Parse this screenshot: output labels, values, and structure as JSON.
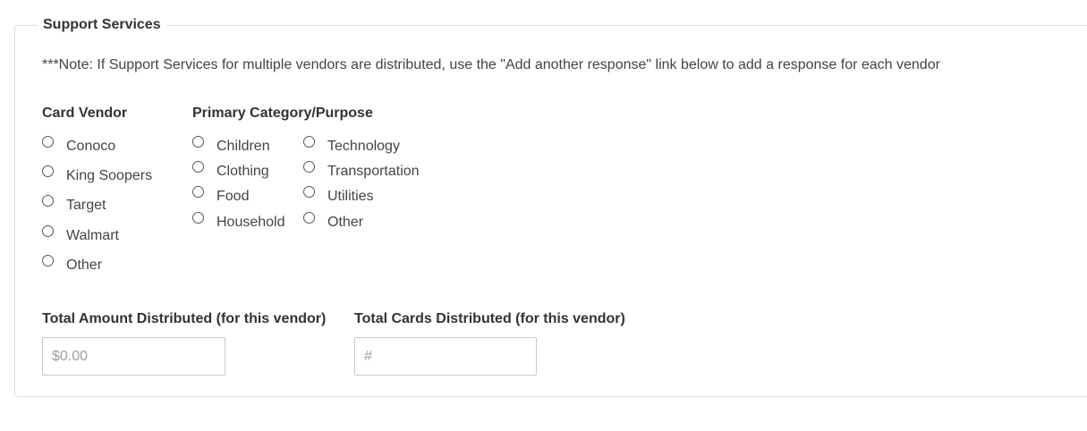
{
  "section": {
    "title": "Support Services",
    "note": "***Note: If Support Services for multiple vendors are distributed, use the \"Add another response\" link below to add a response for each vendor"
  },
  "card_vendor": {
    "label": "Card Vendor",
    "options": [
      "Conoco",
      "King Soopers",
      "Target",
      "Walmart",
      "Other"
    ]
  },
  "primary_category": {
    "label": "Primary Category/Purpose",
    "column1": [
      "Children",
      "Clothing",
      "Food",
      "Household"
    ],
    "column2": [
      "Technology",
      "Transportation",
      "Utilities",
      "Other"
    ]
  },
  "total_amount": {
    "label": "Total Amount Distributed (for this vendor)",
    "placeholder": "$0.00",
    "value": ""
  },
  "total_cards": {
    "label": "Total Cards Distributed (for this vendor)",
    "placeholder": "#",
    "value": ""
  }
}
